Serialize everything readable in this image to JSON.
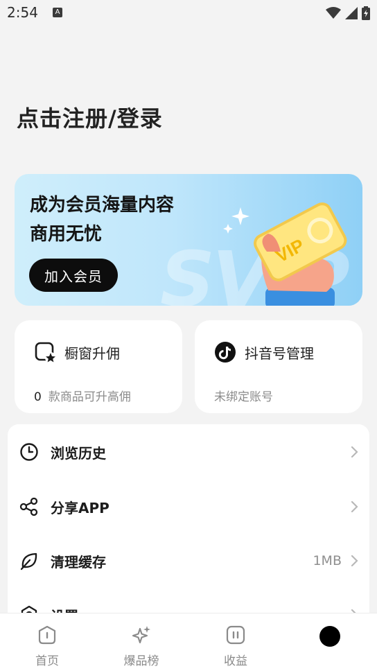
{
  "status_bar": {
    "time": "2:54",
    "notification_badge": "A"
  },
  "header": {
    "login_title": "点击注册/登录"
  },
  "vip_banner": {
    "line1": "成为会员海量内容",
    "line2": "商用无忧",
    "join_button": "加入会员",
    "card_text": "VIP",
    "watermark": "SVIP",
    "accent_colors": [
      "#cfeefb",
      "#8fd0f6",
      "#ffe680"
    ]
  },
  "cards": {
    "showcase": {
      "icon": "store-star-icon",
      "title": "橱窗升佣",
      "count": "0",
      "subtitle": "款商品可升高佣"
    },
    "douyin": {
      "icon": "tiktok-icon",
      "title": "抖音号管理",
      "subtitle": "未绑定账号"
    }
  },
  "menu": {
    "items": [
      {
        "icon": "clock-icon",
        "label": "浏览历史",
        "value": ""
      },
      {
        "icon": "share-icon",
        "label": "分享APP",
        "value": ""
      },
      {
        "icon": "leaf-icon",
        "label": "清理缓存",
        "value": "1MB"
      },
      {
        "icon": "settings-icon",
        "label": "设置",
        "value": ""
      }
    ]
  },
  "bottom_nav": {
    "items": [
      {
        "icon": "home-icon",
        "label": "首页"
      },
      {
        "icon": "sparkle-icon",
        "label": "爆品榜"
      },
      {
        "icon": "earnings-icon",
        "label": "收益"
      },
      {
        "icon": "profile-dot-icon",
        "label": ""
      }
    ]
  }
}
